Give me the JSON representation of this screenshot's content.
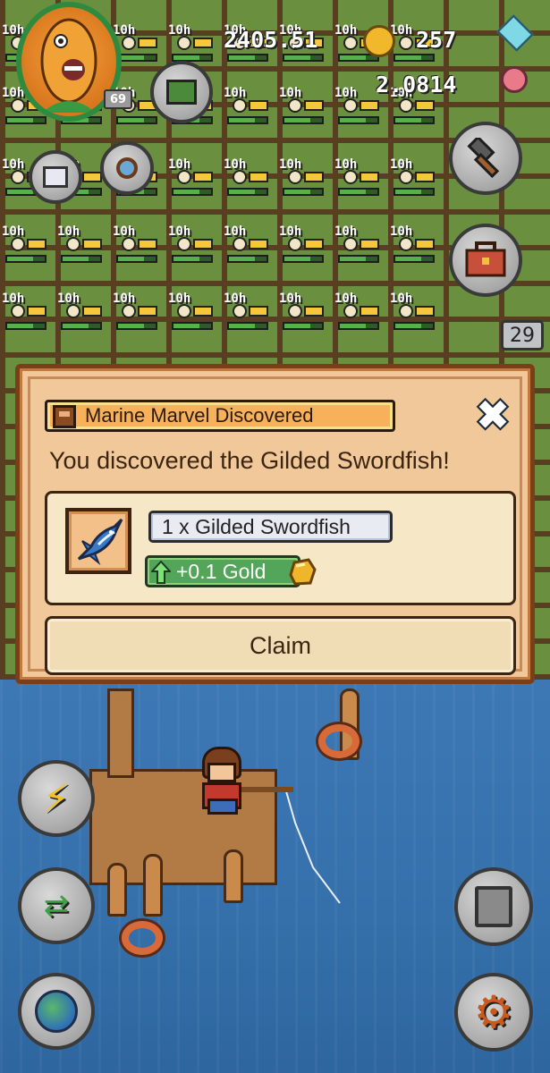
{
  "hud": {
    "coins": "2405.51",
    "gems": "257",
    "gold": "2.0814",
    "level": "69",
    "notification_count": "29"
  },
  "farm": {
    "timer_label": "10h",
    "top_left_timer": "10h"
  },
  "modal": {
    "title": "Marine Marvel Discovered",
    "message": "You discovered the Gilded Swordfish!",
    "item_label": "1 x Gilded Swordfish",
    "reward_label": "+0.1 Gold",
    "claim_label": "Claim",
    "close_symbol": "✖"
  },
  "icons": {
    "avatar": "corn-character-avatar",
    "gold": "gold-nugget-icon",
    "fish": "swordfish-icon",
    "hammer": "hammer-icon",
    "toolbox": "toolbox-icon",
    "lightning": "lightning-icon",
    "trade": "trade-arrows-icon",
    "globe": "globe-icon",
    "save": "floppy-disk-icon",
    "settings": "gear-icon"
  },
  "colors": {
    "modal_bg": "#f0c89a",
    "modal_border": "#7a3e18",
    "title_pill": "#f6b15a",
    "gold_pill": "#53a55a",
    "water": "#3570ab"
  }
}
